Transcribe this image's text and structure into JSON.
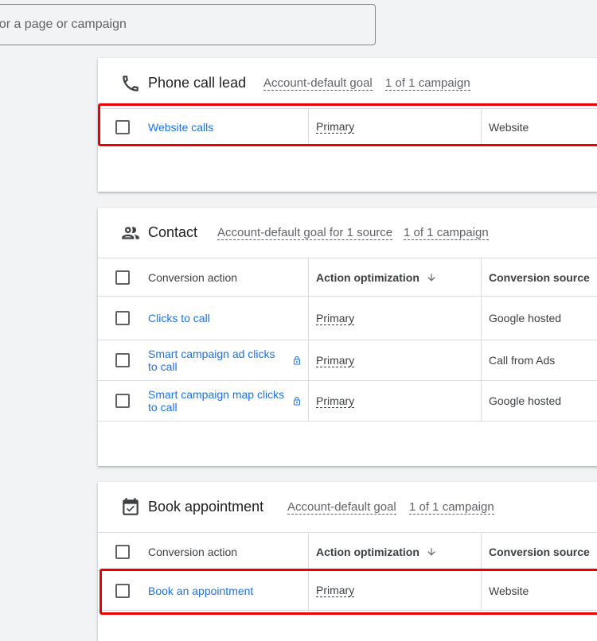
{
  "search": {
    "placeholder": "h for a page or campaign"
  },
  "cards": [
    {
      "title": "Phone call lead",
      "icon": "phone-icon",
      "goal_chip": "Account-default goal",
      "campaign_chip": "1 of 1 campaign",
      "rows": [
        {
          "name": "Website calls",
          "optimization": "Primary",
          "source": "Website"
        }
      ]
    },
    {
      "title": "Contact",
      "icon": "people-icon",
      "goal_chip": "Account-default goal for 1 source",
      "campaign_chip": "1 of 1 campaign",
      "headers": {
        "action": "Conversion action",
        "optimization": "Action optimization",
        "source": "Conversion source"
      },
      "rows": [
        {
          "name": "Clicks to call",
          "optimization": "Primary",
          "source": "Google hosted"
        },
        {
          "name": "Smart campaign ad clicks to call",
          "optimization": "Primary",
          "source": "Call from Ads",
          "locked": true
        },
        {
          "name": "Smart campaign map clicks to call",
          "optimization": "Primary",
          "source": "Google hosted",
          "locked": true
        }
      ]
    },
    {
      "title": "Book appointment",
      "icon": "calendar-check-icon",
      "goal_chip": "Account-default goal",
      "campaign_chip": "1 of 1 campaign",
      "headers": {
        "action": "Conversion action",
        "optimization": "Action optimization",
        "source": "Conversion source"
      },
      "rows": [
        {
          "name": "Book an appointment",
          "optimization": "Primary",
          "source": "Website"
        }
      ]
    }
  ],
  "colors": {
    "link": "#1a73e8",
    "highlight": "#ea0000",
    "border": "#dadce0"
  }
}
